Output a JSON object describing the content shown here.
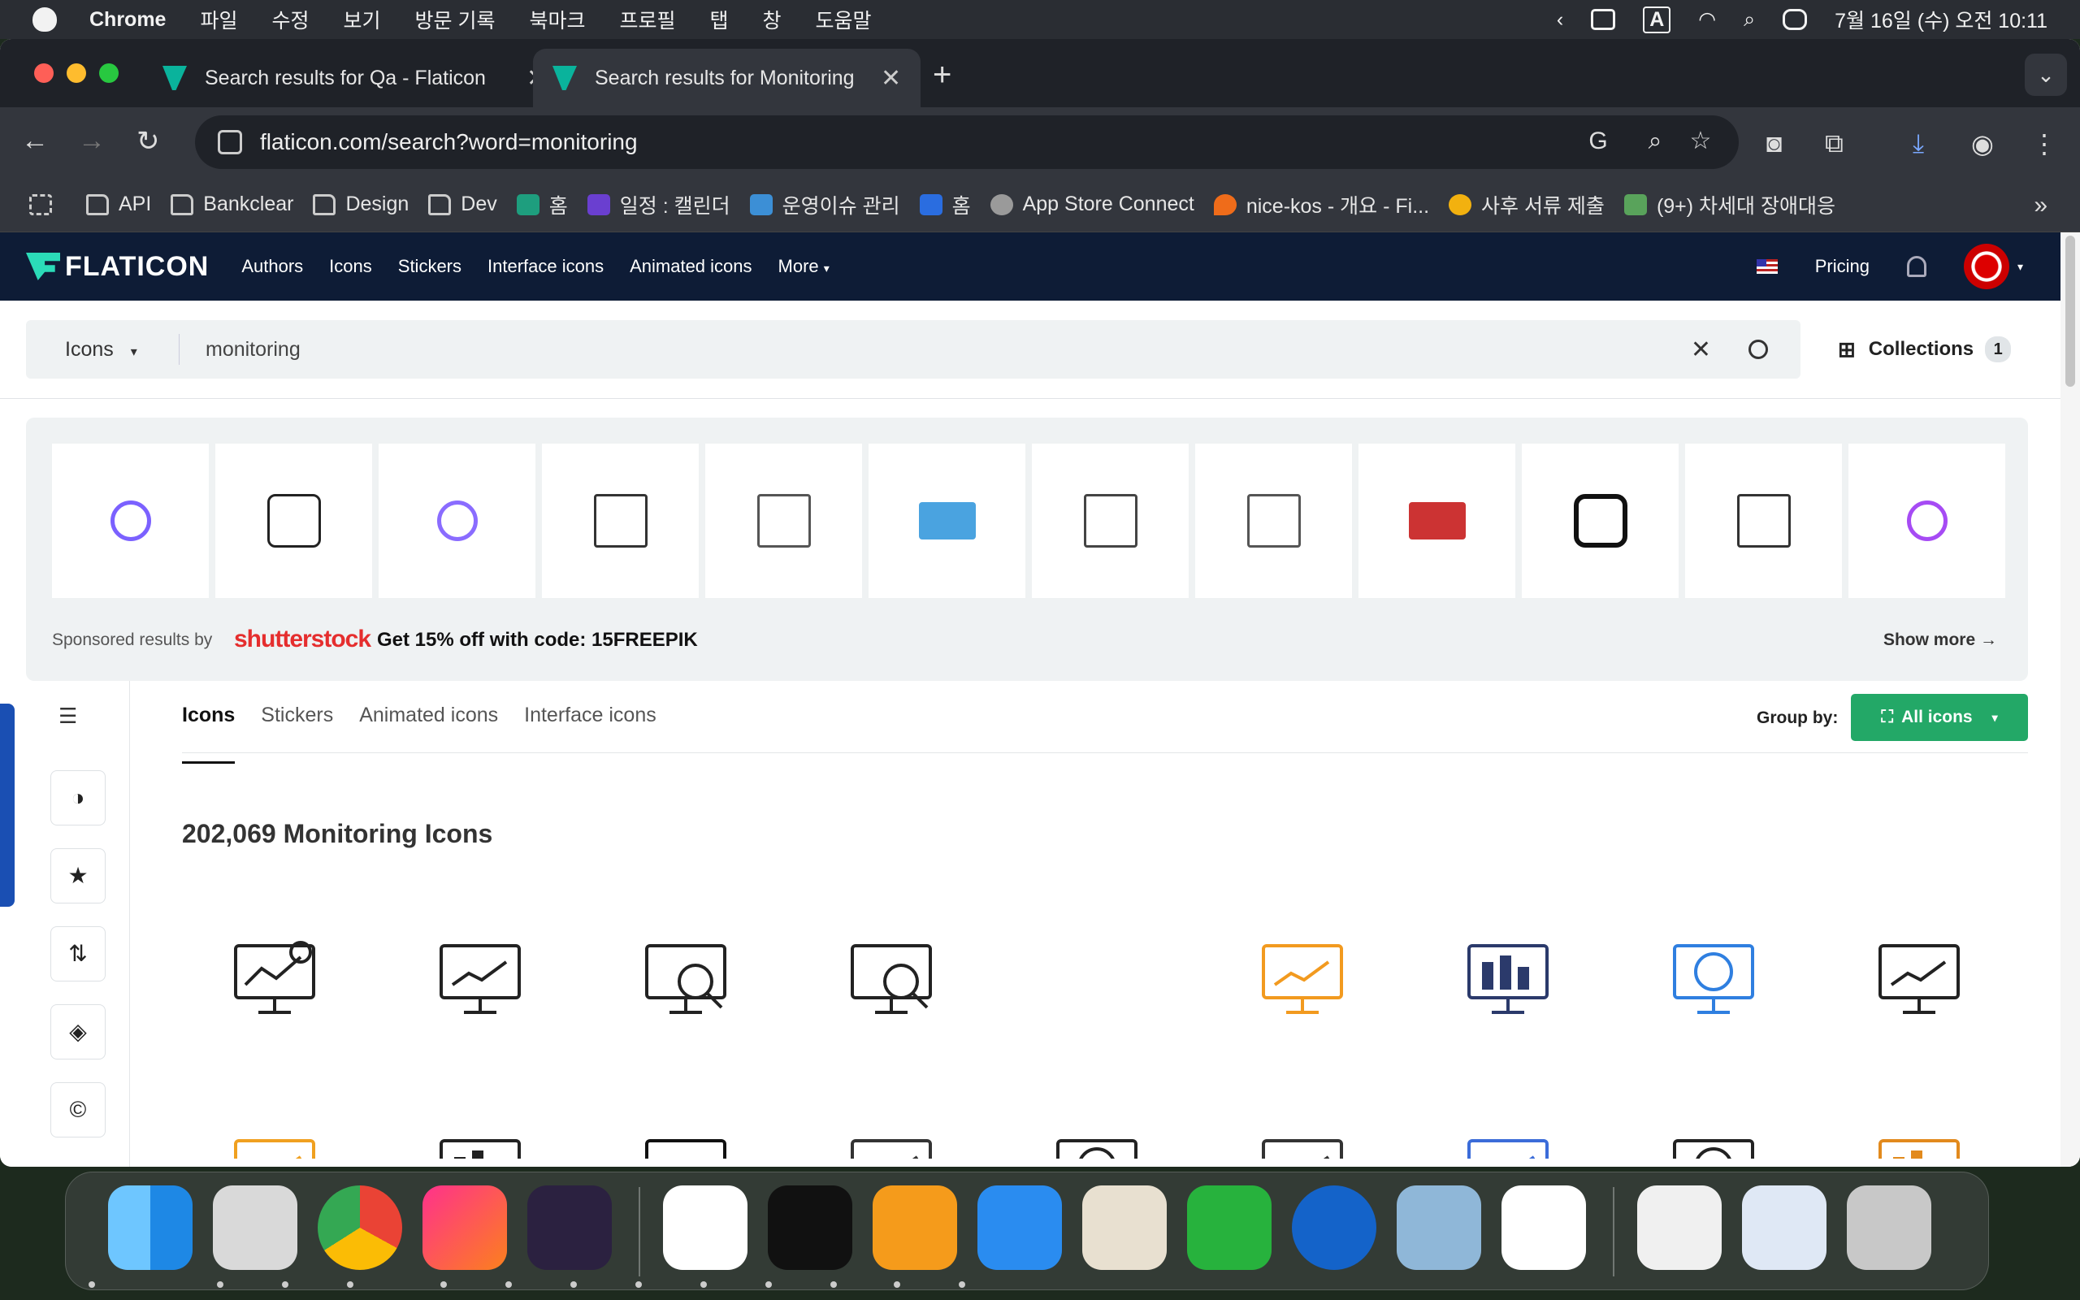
{
  "menubar": {
    "app": "Chrome",
    "items": [
      "파일",
      "수정",
      "보기",
      "방문 기록",
      "북마크",
      "프로필",
      "탭",
      "창",
      "도움말"
    ],
    "input_indicator": "A",
    "clock": "7월 16일 (수) 오전 10:11"
  },
  "tabs": [
    {
      "title": "Search results for Qa - Flaticon",
      "close": "✕"
    },
    {
      "title": "Search results for Monitoring",
      "close": "✕"
    }
  ],
  "new_tab": "+",
  "omnibox": {
    "url": "flaticon.com/search?word=monitoring"
  },
  "bookmarks": [
    {
      "label": "API",
      "icon": "folder-icon"
    },
    {
      "label": "Bankclear",
      "icon": "folder-icon"
    },
    {
      "label": "Design",
      "icon": "folder-icon"
    },
    {
      "label": "Dev",
      "icon": "folder-icon"
    },
    {
      "label": "홈",
      "icon": "app-icon",
      "color": "#1e9e7e"
    },
    {
      "label": "일정 : 캘린더",
      "icon": "calendar-icon",
      "color": "#6a3fd0"
    },
    {
      "label": "운영이슈 관리",
      "icon": "app-icon",
      "color": "#3c8fd6"
    },
    {
      "label": "홈",
      "icon": "app-icon",
      "color": "#2a6de0"
    },
    {
      "label": "App Store Connect",
      "icon": "apple-icon",
      "color": "#9a9a9a"
    },
    {
      "label": "nice-kos - 개요 - Fi...",
      "icon": "fire-icon",
      "color": "#ef6c1a"
    },
    {
      "label": "사후 서류 제출",
      "icon": "app-icon",
      "color": "#f2b10f"
    },
    {
      "label": "(9+) 차세대 장애대응",
      "icon": "app-icon",
      "color": "#59a35b"
    }
  ],
  "flaticon": {
    "brand": "FLATICON",
    "nav": [
      "Authors",
      "Icons",
      "Stickers",
      "Interface icons",
      "Animated icons",
      "More"
    ],
    "pricing": "Pricing",
    "search": {
      "type": "Icons",
      "query": "monitoring"
    },
    "collections": {
      "label": "Collections",
      "count": "1"
    },
    "sponsored": {
      "label": "Sponsored results by",
      "brand": "shutterstock",
      "promo": "Get 15% off with code: 15FREEPIK",
      "show_more": "Show more"
    },
    "content_tabs": [
      "Icons",
      "Stickers",
      "Animated icons",
      "Interface icons"
    ],
    "group_by": {
      "label": "Group by:",
      "value": "All icons"
    },
    "results_title": "202,069 Monitoring Icons"
  },
  "colors": {
    "brand_navy": "#0e1c36",
    "brand_teal": "#2bdbb8",
    "group_green": "#23a867",
    "shutterstock_red": "#e52e2e"
  }
}
